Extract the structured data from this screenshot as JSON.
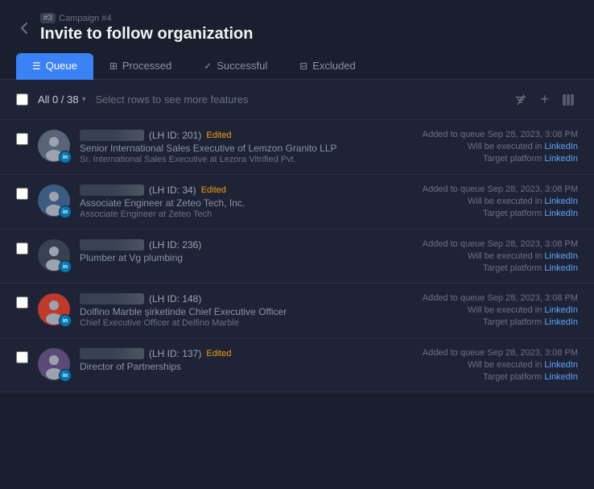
{
  "header": {
    "back_icon": "‹",
    "campaign_label": "Campaign #4",
    "step_badge": "#3",
    "title": "Invite to follow organization"
  },
  "tabs": [
    {
      "id": "queue",
      "label": "Queue",
      "icon": "☰",
      "active": true
    },
    {
      "id": "processed",
      "label": "Processed",
      "icon": "⊞",
      "active": false
    },
    {
      "id": "successful",
      "label": "Successful",
      "icon": "✓",
      "active": false
    },
    {
      "id": "excluded",
      "label": "Excluded",
      "icon": "⊟",
      "active": false
    }
  ],
  "toolbar": {
    "select_count": "All 0 / 38",
    "select_hint": "Select rows to see more features",
    "chevron_icon": "▾",
    "hide_icon": "⊟",
    "add_icon": "+",
    "columns_icon": "⊞"
  },
  "rows": [
    {
      "id": "row1",
      "lh_id": "(LH ID: 201)",
      "name_visible": false,
      "name_text": "",
      "edited": true,
      "title": "Senior International Sales Executive of Lemzon Granito LLP",
      "subtitle": "Sr. International Sales Executive at Lezora Vitrified Pvt.",
      "added": "Added to queue Sep 28, 2023, 3:08 PM",
      "executed": "Will be executed in",
      "executed_platform": "LinkedIn",
      "target": "Target platform",
      "target_platform": "LinkedIn",
      "avatar_color": "#4b5563",
      "avatar_text": ""
    },
    {
      "id": "row2",
      "lh_id": "(LH ID: 34)",
      "name_visible": false,
      "name_text": "",
      "edited": true,
      "title": "Associate Engineer at Zeteo Tech, Inc.",
      "subtitle": "Associate Engineer at Zeteo Tech",
      "added": "Added to queue Sep 28, 2023, 3:08 PM",
      "executed": "Will be executed in",
      "executed_platform": "LinkedIn",
      "target": "Target platform",
      "target_platform": "LinkedIn",
      "avatar_color": "#4b5563",
      "avatar_text": "👤"
    },
    {
      "id": "row3",
      "lh_id": "(LH ID: 236)",
      "name_visible": false,
      "name_text": "",
      "edited": false,
      "title": "Plumber at Vg plumbing",
      "subtitle": "",
      "added": "Added to queue Sep 28, 2023, 3:08 PM",
      "executed": "Will be executed in",
      "executed_platform": "LinkedIn",
      "target": "Target platform",
      "target_platform": "LinkedIn",
      "avatar_color": "#374151",
      "avatar_text": "👤"
    },
    {
      "id": "row4",
      "lh_id": "(LH ID: 148)",
      "name_visible": false,
      "name_text": "",
      "edited": false,
      "title": "Dolfino Marble şirketinde Chief Executive Officer",
      "subtitle": "Chief Executive Officer at Delfino Marble",
      "added": "Added to queue Sep 28, 2023, 3:08 PM",
      "executed": "Will be executed in",
      "executed_platform": "LinkedIn",
      "target": "Target platform",
      "target_platform": "LinkedIn",
      "avatar_color": "#4b5563",
      "avatar_text": ""
    },
    {
      "id": "row5",
      "lh_id": "(LH ID: 137)",
      "name_visible": false,
      "name_text": "",
      "edited": true,
      "title": "Director of Partnerships",
      "subtitle": "",
      "added": "Added to queue Sep 28, 2023, 3:08 PM",
      "executed": "Will be executed in",
      "executed_platform": "LinkedIn",
      "target": "Target platform",
      "target_platform": "LinkedIn",
      "avatar_color": "#4b5563",
      "avatar_text": ""
    }
  ],
  "labels": {
    "edited": "Edited",
    "will_be_executed_in": "Will be executed in",
    "target_platform": "Target platform",
    "linkedin": "LinkedIn"
  },
  "avatars": {
    "row1_has_img": false,
    "row2_has_img": true,
    "row3_has_img": false,
    "row4_has_img": true,
    "row5_has_img": true
  }
}
